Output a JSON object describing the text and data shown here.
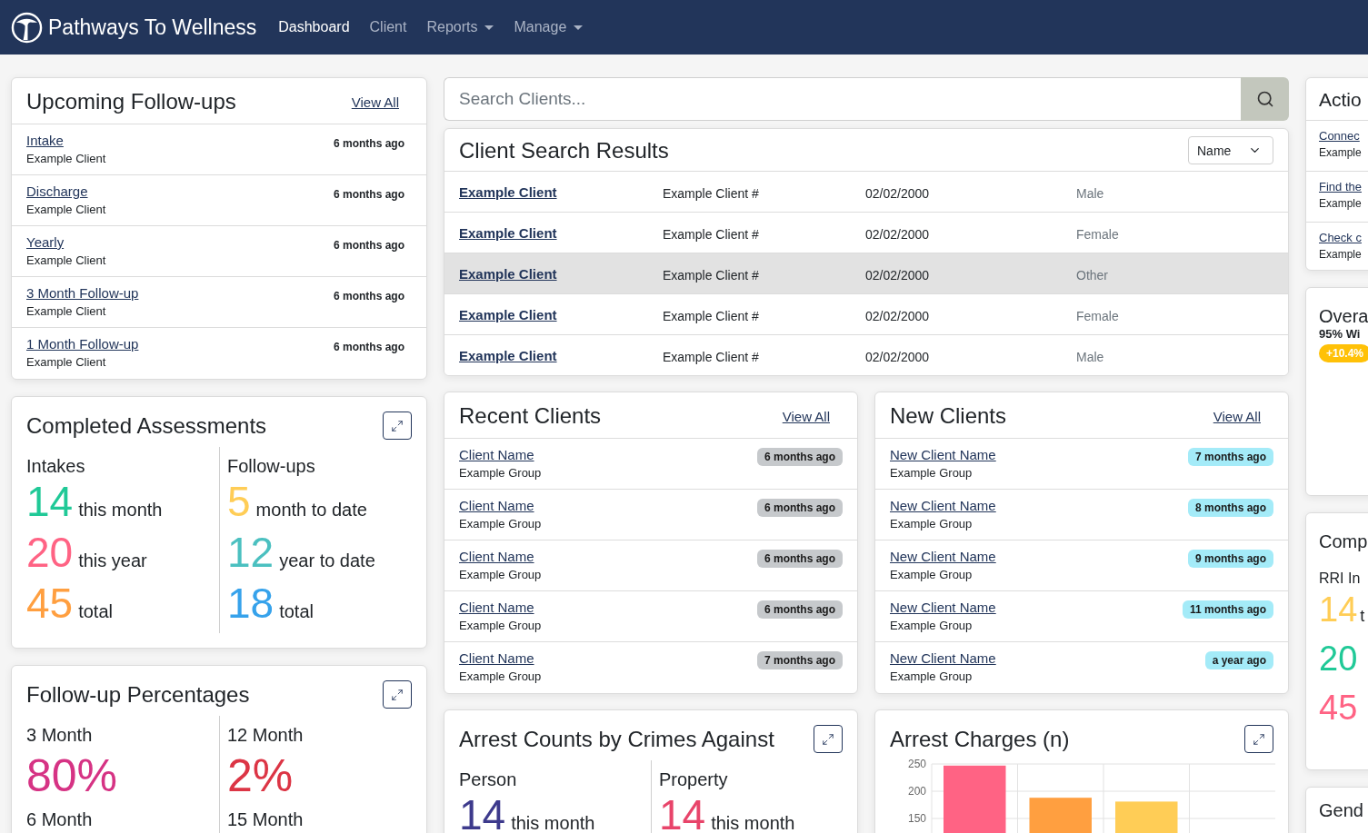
{
  "navbar": {
    "brand": "Pathways To Wellness",
    "links": [
      {
        "label": "Dashboard",
        "selected": true,
        "dropdown": false
      },
      {
        "label": "Client",
        "selected": false,
        "dropdown": false
      },
      {
        "label": "Reports",
        "selected": false,
        "dropdown": true
      },
      {
        "label": "Manage",
        "selected": false,
        "dropdown": true
      }
    ]
  },
  "followups": {
    "title": "Upcoming Follow-ups",
    "view_all": "View All",
    "items": [
      {
        "title": "Intake",
        "subtitle": "Example Client",
        "time": "6 months ago"
      },
      {
        "title": "Discharge",
        "subtitle": "Example Client",
        "time": "6 months ago"
      },
      {
        "title": "Yearly",
        "subtitle": "Example Client",
        "time": "6 months ago"
      },
      {
        "title": "3 Month Follow-up",
        "subtitle": "Example Client",
        "time": "6 months ago"
      },
      {
        "title": "1 Month Follow-up",
        "subtitle": "Example Client",
        "time": "6 months ago"
      }
    ]
  },
  "completed_assessments": {
    "title": "Completed Assessments",
    "columns": [
      {
        "heading": "Intakes",
        "stats": [
          {
            "value": "14",
            "label": "this month",
            "color": "#20c997"
          },
          {
            "value": "20",
            "label": "this year",
            "color": "#ff6384"
          },
          {
            "value": "45",
            "label": "total",
            "color": "#ff9f40"
          }
        ]
      },
      {
        "heading": "Follow-ups",
        "stats": [
          {
            "value": "5",
            "label": "month to date",
            "color": "#ffcd56"
          },
          {
            "value": "12",
            "label": "year to date",
            "color": "#4bc0c0"
          },
          {
            "value": "18",
            "label": "total",
            "color": "#36a2eb"
          }
        ]
      }
    ]
  },
  "followup_percentages": {
    "title": "Follow-up Percentages",
    "columns": [
      {
        "items": [
          {
            "label": "3 Month",
            "value": "80%",
            "color": "#d63384"
          },
          {
            "label": "6 Month"
          }
        ]
      },
      {
        "items": [
          {
            "label": "12 Month",
            "value": "2%",
            "color": "#dc3545"
          },
          {
            "label": "15 Month"
          }
        ]
      }
    ]
  },
  "search": {
    "placeholder": "Search Clients..."
  },
  "search_results": {
    "title": "Client Search Results",
    "sort": "Name",
    "rows": [
      {
        "name": "Example Client",
        "number": "Example Client #",
        "dob": "02/02/2000",
        "gender": "Male",
        "selected": false
      },
      {
        "name": "Example Client",
        "number": "Example Client #",
        "dob": "02/02/2000",
        "gender": "Female",
        "selected": false
      },
      {
        "name": "Example Client",
        "number": "Example Client #",
        "dob": "02/02/2000",
        "gender": "Other",
        "selected": true
      },
      {
        "name": "Example Client",
        "number": "Example Client #",
        "dob": "02/02/2000",
        "gender": "Female",
        "selected": false
      },
      {
        "name": "Example Client",
        "number": "Example Client #",
        "dob": "02/02/2000",
        "gender": "Male",
        "selected": false
      }
    ]
  },
  "recent_clients": {
    "title": "Recent Clients",
    "view_all": "View All",
    "items": [
      {
        "name": "Client Name",
        "group": "Example Group",
        "time": "6 months ago"
      },
      {
        "name": "Client Name",
        "group": "Example Group",
        "time": "6 months ago"
      },
      {
        "name": "Client Name",
        "group": "Example Group",
        "time": "6 months ago"
      },
      {
        "name": "Client Name",
        "group": "Example Group",
        "time": "6 months ago"
      },
      {
        "name": "Client Name",
        "group": "Example Group",
        "time": "7 months ago"
      }
    ]
  },
  "new_clients": {
    "title": "New Clients",
    "view_all": "View All",
    "items": [
      {
        "name": "New Client Name",
        "group": "Example Group",
        "time": "7 months ago"
      },
      {
        "name": "New Client Name",
        "group": "Example Group",
        "time": "8 months ago"
      },
      {
        "name": "New Client Name",
        "group": "Example Group",
        "time": "9 months ago"
      },
      {
        "name": "New Client Name",
        "group": "Example Group",
        "time": "11 months ago"
      },
      {
        "name": "New Client Name",
        "group": "Example Group",
        "time": "a year ago"
      }
    ]
  },
  "arrest_counts": {
    "title": "Arrest Counts by Crimes Against",
    "columns": [
      {
        "heading": "Person",
        "value": "14",
        "label": "this month",
        "color": "#3d3a8c"
      },
      {
        "heading": "Property",
        "value": "14",
        "label": "this month",
        "color": "#e8446a"
      }
    ]
  },
  "arrest_charges": {
    "title": "Arrest Charges (n)",
    "chart_data": {
      "type": "bar",
      "values": [
        247,
        188,
        181,
        null
      ],
      "ylim": [
        110,
        250
      ],
      "yticks": [
        150,
        200,
        250
      ]
    }
  },
  "actions": {
    "title": "Actio",
    "items": [
      {
        "title": "Connec",
        "subtitle": "Example"
      },
      {
        "title": "Find the",
        "subtitle": "Example"
      },
      {
        "title": "Check c",
        "subtitle": "Example"
      }
    ]
  },
  "overall": {
    "title": "Overa",
    "subtitle": "95% Wi",
    "badge": "+10.4%"
  },
  "completed_rri": {
    "title": "Comp",
    "heading": "RRI In",
    "stats": [
      {
        "value": "14",
        "label": "t",
        "color": "#ffcd56"
      },
      {
        "value": "20",
        "color": "#20c997"
      },
      {
        "value": "45",
        "color": "#ff6384"
      }
    ]
  },
  "gender": {
    "title": "Gend"
  }
}
